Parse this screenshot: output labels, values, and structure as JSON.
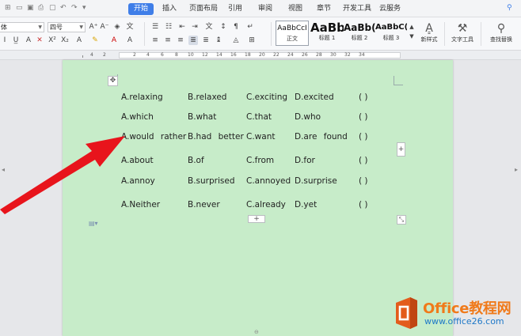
{
  "tabs": [
    "开始",
    "插入",
    "页面布局",
    "引用",
    "审阅",
    "视图",
    "章节",
    "开发工具",
    "云服务"
  ],
  "active_tab": "开始",
  "font": {
    "name": "体",
    "size": "四号"
  },
  "styles": [
    {
      "preview": "AaBbCcI",
      "label": "正文"
    },
    {
      "preview": "AaBb",
      "label": "标题 1"
    },
    {
      "preview": "AaBb(",
      "label": "标题 2"
    },
    {
      "preview": "AaBbC(",
      "label": "标题 3"
    }
  ],
  "ribbon_tools": {
    "new_style": "新样式",
    "text_tools": "文字工具",
    "find_replace": "查找替换"
  },
  "ruler_numbers": [
    "4",
    "2",
    "2",
    "4",
    "6",
    "8",
    "10",
    "12",
    "14",
    "16",
    "18",
    "20",
    "22",
    "24",
    "26",
    "28",
    "30",
    "32",
    "34"
  ],
  "table": {
    "rows": [
      [
        "A.relaxing",
        "B.relaxed",
        "C.exciting",
        "D.excited"
      ],
      [
        "A.which",
        "B.what",
        "C.that",
        "D.who"
      ],
      [
        "A.would rather",
        "B.had better",
        "C.want",
        "D.are found"
      ],
      [
        "A.about",
        "B.of",
        "C.from",
        "D.for"
      ],
      [
        "A.annoy",
        "B.surprised",
        "C.annoyed",
        "D.surprise"
      ],
      [
        "A.Neither",
        "B.never",
        "C.already",
        "D.yet"
      ]
    ],
    "paren": "(        )"
  },
  "watermark": {
    "name": "Office教程网",
    "url": "www.office26.com"
  },
  "colors": {
    "page": "#c7ecc9",
    "accent": "#3f7ee8",
    "arrow": "#e8141c",
    "wm_orange": "#f07a1a",
    "wm_blue": "#1e78c8"
  }
}
